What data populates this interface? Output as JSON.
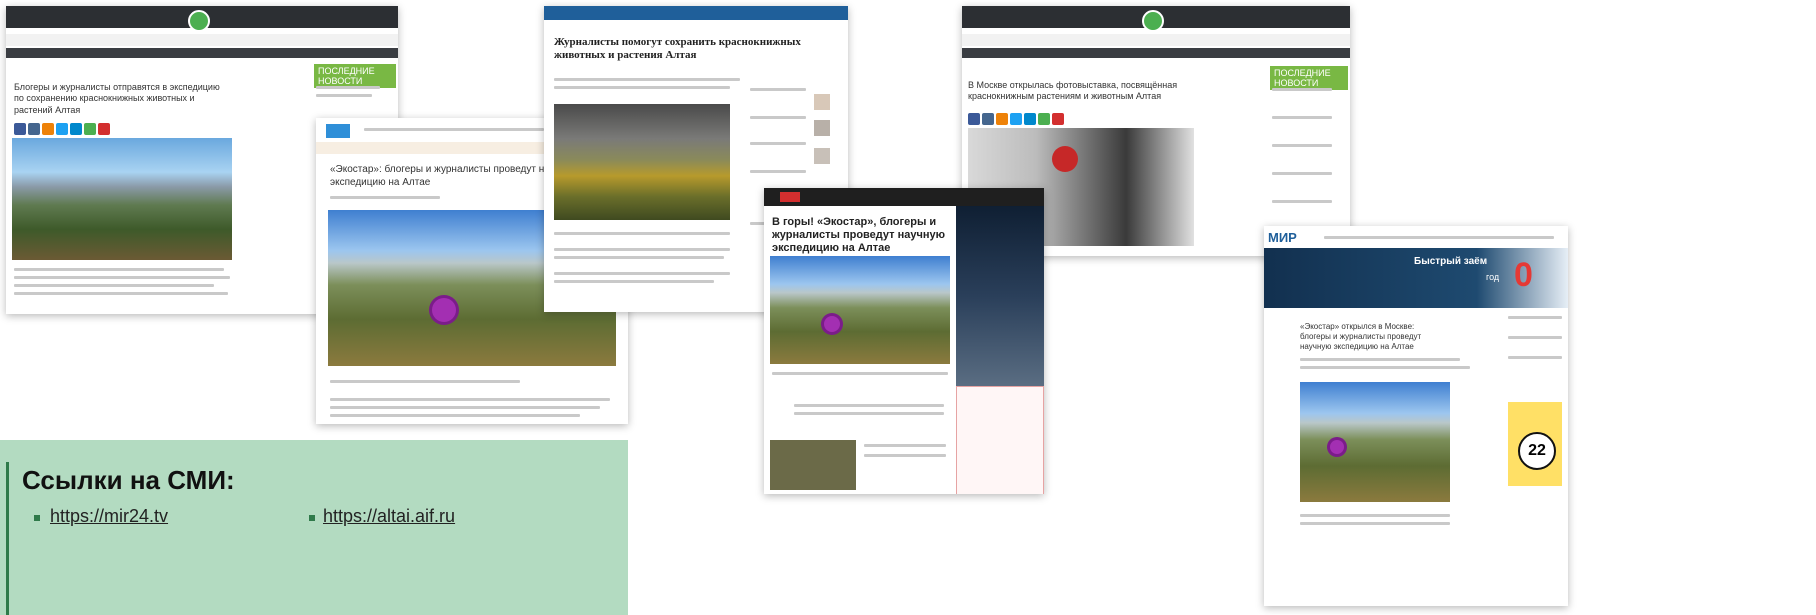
{
  "links_panel": {
    "title": "Ссылки на СМИ:",
    "links": [
      "https://mir24.tv",
      "https://altai.aif.ru"
    ]
  },
  "articles": {
    "a1": {
      "title": "Блогеры и журналисты отправятся в экспедицию по сохранению краснокнижных животных и растений Алтая",
      "sidebar_badge": "ПОСЛЕДНИЕ НОВОСТИ"
    },
    "a2": {
      "title": "«Экостар»: блогеры и журналисты проведут научную экспедицию на Алтае"
    },
    "a3": {
      "title": "Журналисты помогут сохранить краснокнижных животных и растения Алтая"
    },
    "a4": {
      "title": "В горы! «Экостар», блогеры и журналисты проведут научную экспедицию на Алтае"
    },
    "a5": {
      "title": "В Москве открылась фотовыставка, посвящённая краснокнижным растениям и животным Алтая",
      "sidebar_badge": "ПОСЛЕДНИЕ НОВОСТИ"
    },
    "a6": {
      "title": "«Экостар» открылся в Москве: блогеры и журналисты проведут научную экспедицию на Алтае",
      "logo": "МИР",
      "ad_text": "Быстрый заём",
      "ad_number": "0",
      "ad_unit": "год",
      "promo_number": "22"
    }
  },
  "colors": {
    "accent_green": "#79b844",
    "panel_green": "#b3dbc1",
    "dark_bar": "#2c2f33"
  }
}
